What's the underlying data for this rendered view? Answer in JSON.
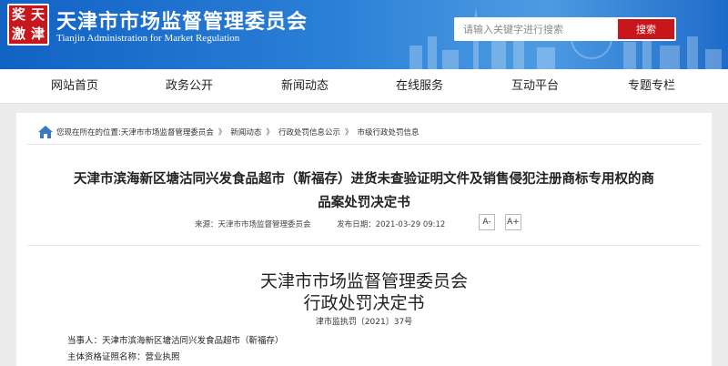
{
  "header": {
    "title_cn": "天津市市场监督管理委员会",
    "title_en": "Tianjin Administration for Market Regulation",
    "logo_text": [
      "奖",
      "天",
      "激",
      "津"
    ]
  },
  "search": {
    "placeholder": "请输入关键字进行搜索",
    "button": "搜索"
  },
  "nav": {
    "items": [
      {
        "label": "网站首页"
      },
      {
        "label": "政务公开"
      },
      {
        "label": "新闻动态"
      },
      {
        "label": "在线服务"
      },
      {
        "label": "互动平台"
      },
      {
        "label": "专题专栏"
      }
    ]
  },
  "breadcrumb": {
    "prefix": "您现在所在的位置:",
    "items": [
      "天津市市场监督管理委员会",
      "新闻动态",
      "行政处罚信息公示",
      "市级行政处罚信息"
    ],
    "separator": "》"
  },
  "article": {
    "title_line1": "天津市滨海新区塘沽同兴发食品超市（靳福存）进货未查验证明文件及销售侵犯注册商标专用权的商",
    "title_line2": "品案处罚决定书",
    "source": "来源：天津市市场监督管理委员会",
    "date": "发布日期：2021-03-29 09:12",
    "font_decrease": "A-",
    "font_increase": "A+"
  },
  "document": {
    "heading1": "天津市市场监督管理委员会",
    "heading2": "行政处罚决定书",
    "number": "津市监执罚〔2021〕37号",
    "party": "当事人：天津市滨海新区塘沽同兴发食品超市（靳福存）",
    "license_type": "主体资格证照名称：营业执照"
  },
  "colors": {
    "header_blue": "#1e6cc9",
    "accent_red": "#c8161d",
    "home_icon_blue": "#3a78c4"
  }
}
